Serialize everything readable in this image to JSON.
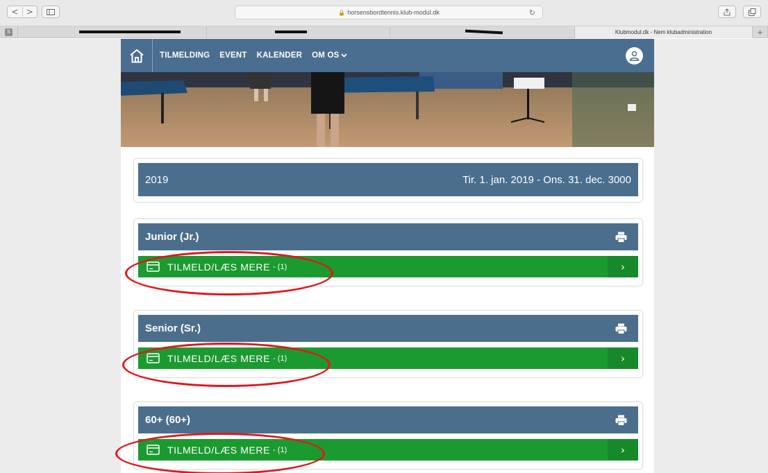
{
  "browser": {
    "url": "horsensbordtennis.klub-modul.dk",
    "active_tab": "Klubmodul.dk - Nem klubadministration",
    "favicon_letter": "S",
    "back": "<",
    "forward": ">",
    "new_tab": "+"
  },
  "nav": {
    "items": [
      "TILMELDING",
      "EVENT",
      "KALENDER",
      "OM OS"
    ],
    "dropdown_chevron": "⌵"
  },
  "season": {
    "year": "2019",
    "range": "Tir. 1. jan. 2019  -  Ons. 31. dec. 3000"
  },
  "groups": [
    {
      "name": "Junior (Jr.)",
      "enroll_label": "TILMELD/LÆS MERE",
      "count": "- (1)"
    },
    {
      "name": "Senior (Sr.)",
      "enroll_label": "TILMELD/LÆS MERE",
      "count": "- (1)"
    },
    {
      "name": "60+ (60+)",
      "enroll_label": "TILMELD/LÆS MERE",
      "count": "- (1)"
    }
  ],
  "colors": {
    "brand_blue": "#4a6e8f",
    "enroll_green": "#1b9a30",
    "annotation_red": "#e2161a"
  }
}
